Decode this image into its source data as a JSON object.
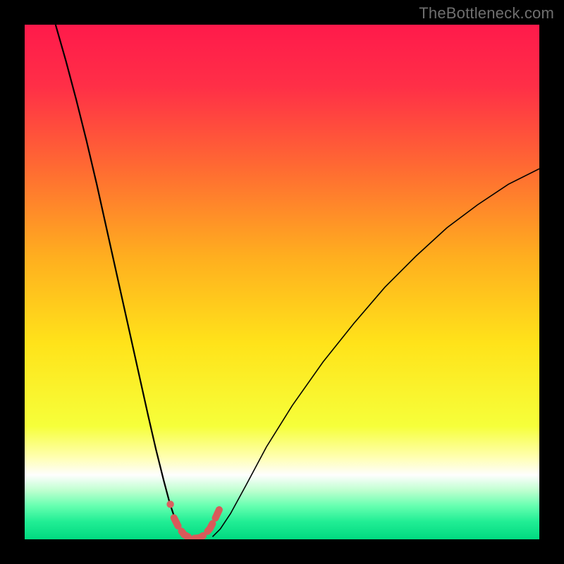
{
  "watermark": "TheBottleneck.com",
  "chart_data": {
    "type": "line",
    "title": "",
    "xlabel": "",
    "ylabel": "",
    "xlim": [
      0,
      100
    ],
    "ylim": [
      0,
      100
    ],
    "gradient_stops": [
      {
        "offset": 0.0,
        "color": "#ff1a4b"
      },
      {
        "offset": 0.12,
        "color": "#ff2f47"
      },
      {
        "offset": 0.28,
        "color": "#ff6b32"
      },
      {
        "offset": 0.45,
        "color": "#ffae1f"
      },
      {
        "offset": 0.62,
        "color": "#ffe31a"
      },
      {
        "offset": 0.78,
        "color": "#f6ff3a"
      },
      {
        "offset": 0.84,
        "color": "#ffffb0"
      },
      {
        "offset": 0.875,
        "color": "#fefefe"
      },
      {
        "offset": 0.905,
        "color": "#bfffd0"
      },
      {
        "offset": 0.935,
        "color": "#66ffb0"
      },
      {
        "offset": 0.965,
        "color": "#22ee95"
      },
      {
        "offset": 1.0,
        "color": "#00d980"
      }
    ],
    "series": [
      {
        "name": "curve-left",
        "stroke": "#000000",
        "stroke_width": 2.2,
        "x": [
          6.0,
          8.0,
          10.0,
          12.0,
          14.0,
          16.0,
          18.0,
          20.0,
          22.0,
          24.0,
          25.5,
          27.0,
          28.2,
          29.3,
          30.2,
          30.8
        ],
        "y": [
          100.0,
          93.0,
          85.5,
          77.5,
          69.0,
          60.0,
          51.0,
          42.0,
          33.0,
          24.0,
          17.5,
          11.5,
          7.0,
          3.7,
          1.5,
          0.4
        ]
      },
      {
        "name": "curve-right",
        "stroke": "#000000",
        "stroke_width": 1.6,
        "x": [
          36.5,
          38.0,
          40.0,
          43.0,
          47.0,
          52.0,
          58.0,
          64.0,
          70.0,
          76.0,
          82.0,
          88.0,
          94.0,
          100.0
        ],
        "y": [
          0.5,
          2.0,
          5.0,
          10.5,
          18.0,
          26.0,
          34.5,
          42.0,
          49.0,
          55.0,
          60.5,
          65.0,
          69.0,
          72.0
        ]
      },
      {
        "name": "marker-band",
        "stroke": "#d95a5a",
        "stroke_width": 10,
        "dash": [
          13,
          9
        ],
        "linecap": "round",
        "x": [
          29.0,
          30.0,
          31.0,
          32.0,
          33.0,
          34.0,
          35.0,
          36.0,
          37.0,
          38.0
        ],
        "y": [
          4.2,
          2.2,
          0.9,
          0.35,
          0.2,
          0.3,
          0.9,
          2.1,
          4.0,
          6.2
        ]
      }
    ],
    "marker_dot": {
      "x": 28.3,
      "y": 6.8,
      "r": 5.2,
      "color": "#dc5f5f"
    }
  }
}
